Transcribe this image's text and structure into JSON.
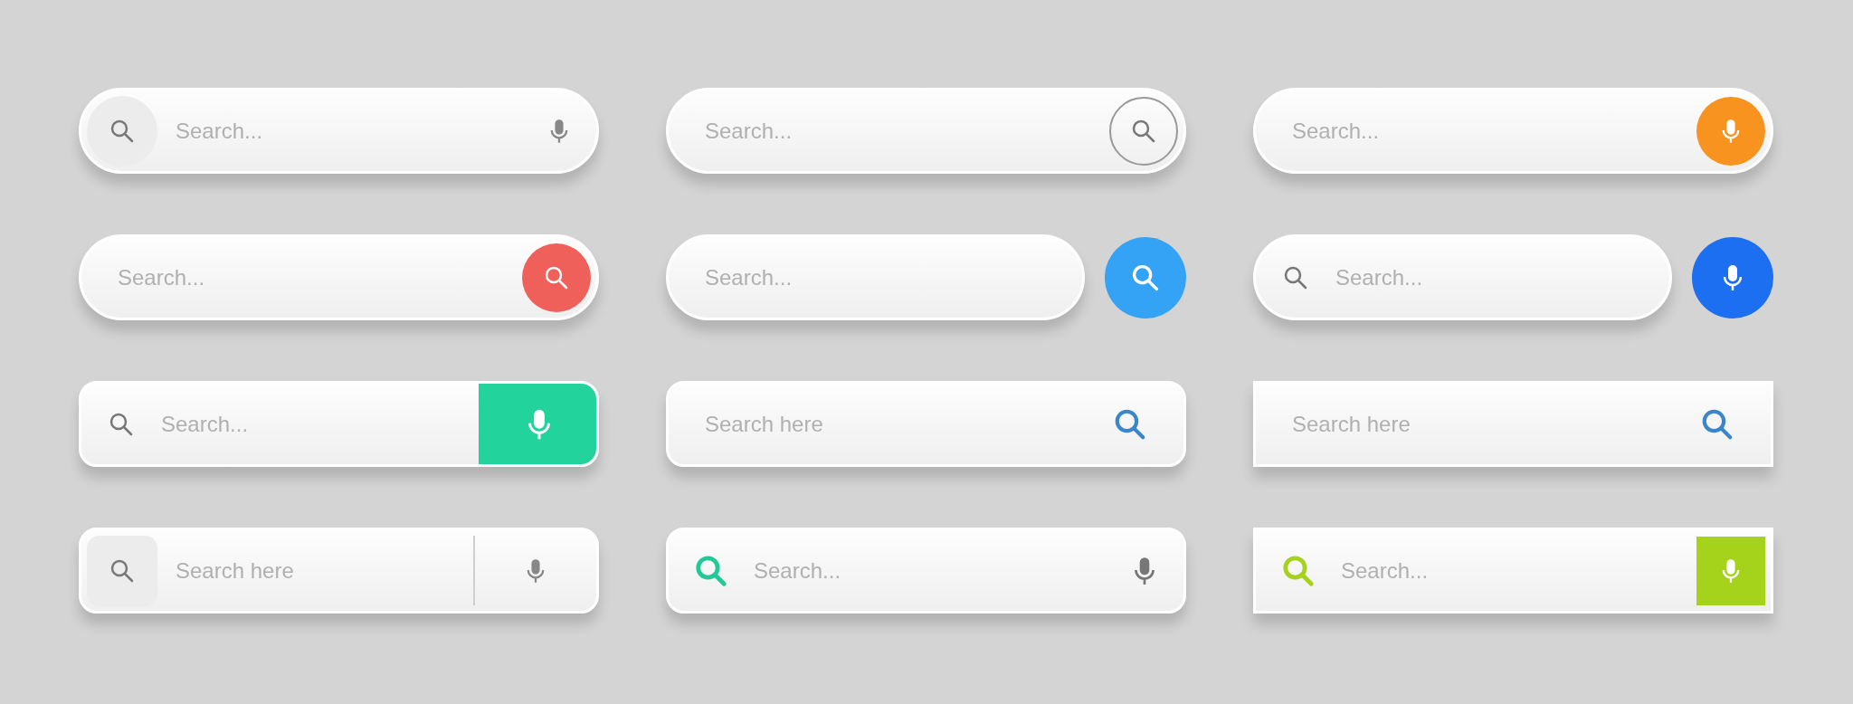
{
  "bars": [
    {
      "kind": "grey-circle-left-mic",
      "placeholder": "Search..."
    },
    {
      "kind": "outline-circle-search",
      "placeholder": "Search..."
    },
    {
      "kind": "filled-mic-inside",
      "placeholder": "Search...",
      "color": "#f7931e"
    },
    {
      "kind": "filled-search-inside",
      "placeholder": "Search...",
      "color": "#f0605a"
    },
    {
      "kind": "filled-search-outside",
      "placeholder": "Search...",
      "color": "#35a3f5"
    },
    {
      "kind": "filled-mic-outside",
      "placeholder": "Search...",
      "color": "#1b6ff0"
    },
    {
      "kind": "block-mic",
      "placeholder": "Search...",
      "color": "#22d39c"
    },
    {
      "kind": "colored-search-right",
      "placeholder": "Search here",
      "color": "#3a86c8"
    },
    {
      "kind": "square-colored-search-right",
      "placeholder": "Search here",
      "color": "#3a86c8"
    },
    {
      "kind": "grey-square-left-divider-mic",
      "placeholder": "Search here"
    },
    {
      "kind": "colored-search-left-mic",
      "placeholder": "Search...",
      "color": "#22c997"
    },
    {
      "kind": "square-colored-search-left-square-mic",
      "placeholder": "Search...",
      "color": "#a5d21a"
    }
  ]
}
